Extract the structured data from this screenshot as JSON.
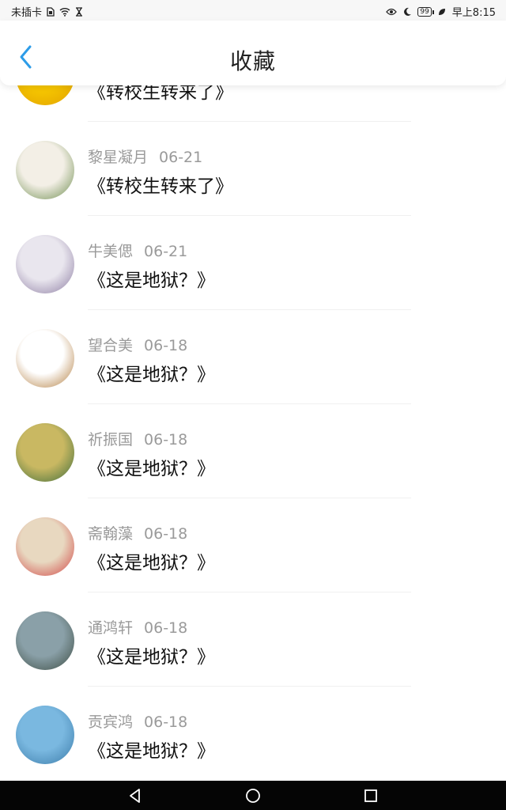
{
  "status_bar": {
    "carrier": "未插卡",
    "battery": "99",
    "time": "早上8:15"
  },
  "header": {
    "title": "收藏"
  },
  "items": [
    {
      "user": "",
      "date": "",
      "title": "《转校生转来了》",
      "avatar_colors": [
        "#f5c400",
        "#e0a000"
      ]
    },
    {
      "user": "黎星凝月",
      "date": "06-21",
      "title": "《转校生转来了》",
      "avatar_colors": [
        "#f3efe6",
        "#6a8a4a"
      ]
    },
    {
      "user": "牛美偲",
      "date": "06-21",
      "title": "《这是地狱？》",
      "avatar_colors": [
        "#e9e6ee",
        "#8a7aa0"
      ]
    },
    {
      "user": "望合美",
      "date": "06-18",
      "title": "《这是地狱？》",
      "avatar_colors": [
        "#ffffff",
        "#b07a3a"
      ]
    },
    {
      "user": "祈振国",
      "date": "06-18",
      "title": "《这是地狱？》",
      "avatar_colors": [
        "#c9b862",
        "#3a6a3a"
      ]
    },
    {
      "user": "斋翰藻",
      "date": "06-18",
      "title": "《这是地狱？》",
      "avatar_colors": [
        "#e8d8c0",
        "#d04040"
      ]
    },
    {
      "user": "通鸿轩",
      "date": "06-18",
      "title": "《这是地狱？》",
      "avatar_colors": [
        "#8aa0a8",
        "#3a4a40"
      ]
    },
    {
      "user": "贡宾鸿",
      "date": "06-18",
      "title": "《这是地狱？》",
      "avatar_colors": [
        "#7ab8e0",
        "#3a7aa8"
      ]
    }
  ]
}
